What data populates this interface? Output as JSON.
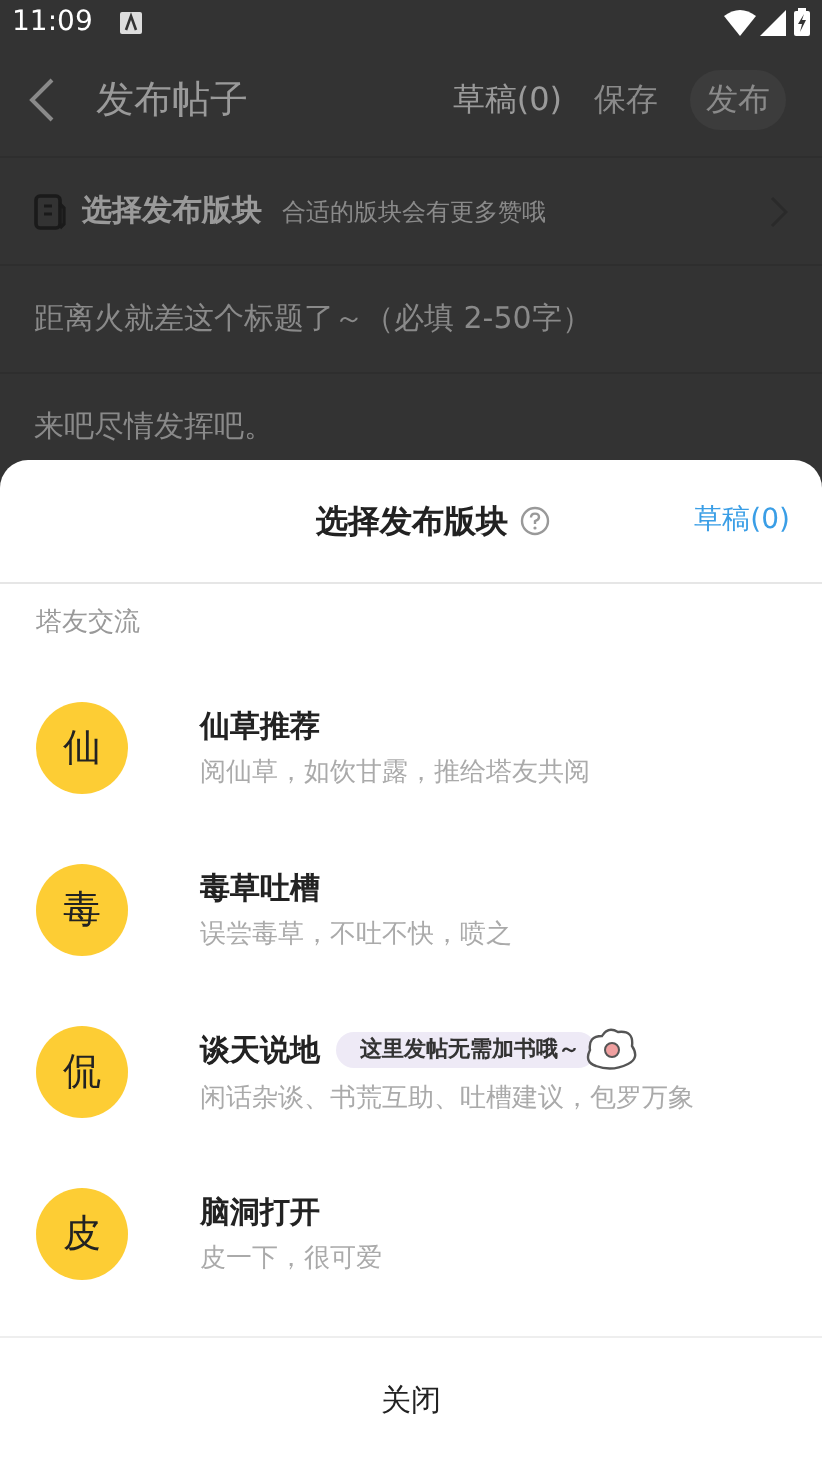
{
  "status_bar": {
    "time": "11:09"
  },
  "header": {
    "title": "发布帖子",
    "actions": [
      {
        "label": "草稿(0)",
        "kind": "text"
      },
      {
        "label": "保存",
        "kind": "text"
      },
      {
        "label": "发布",
        "kind": "pill"
      }
    ]
  },
  "section_row": {
    "label": "选择发布版块",
    "hint": "合适的版块会有更多赞哦"
  },
  "title_field": {
    "placeholder": "距离火就差这个标题了～（必填 2-50字）"
  },
  "body_field": {
    "placeholder": "来吧尽情发挥吧。"
  },
  "sheet": {
    "title": "选择发布版块",
    "drafts": "草稿(0)",
    "group": "塔友交流",
    "items": [
      {
        "badge": "仙",
        "name": "仙草推荐",
        "desc": "阅仙草，如饮甘露，推给塔友共阅"
      },
      {
        "badge": "毒",
        "name": "毒草吐槽",
        "desc": "误尝毒草，不吐不快，喷之"
      },
      {
        "badge": "侃",
        "name": "谈天说地",
        "desc": "闲话杂谈、书荒互助、吐槽建议，包罗万象",
        "tip": "这里发帖无需加书哦～"
      },
      {
        "badge": "皮",
        "name": "脑洞打开",
        "desc": "皮一下，很可爱"
      }
    ],
    "close": "关闭"
  }
}
